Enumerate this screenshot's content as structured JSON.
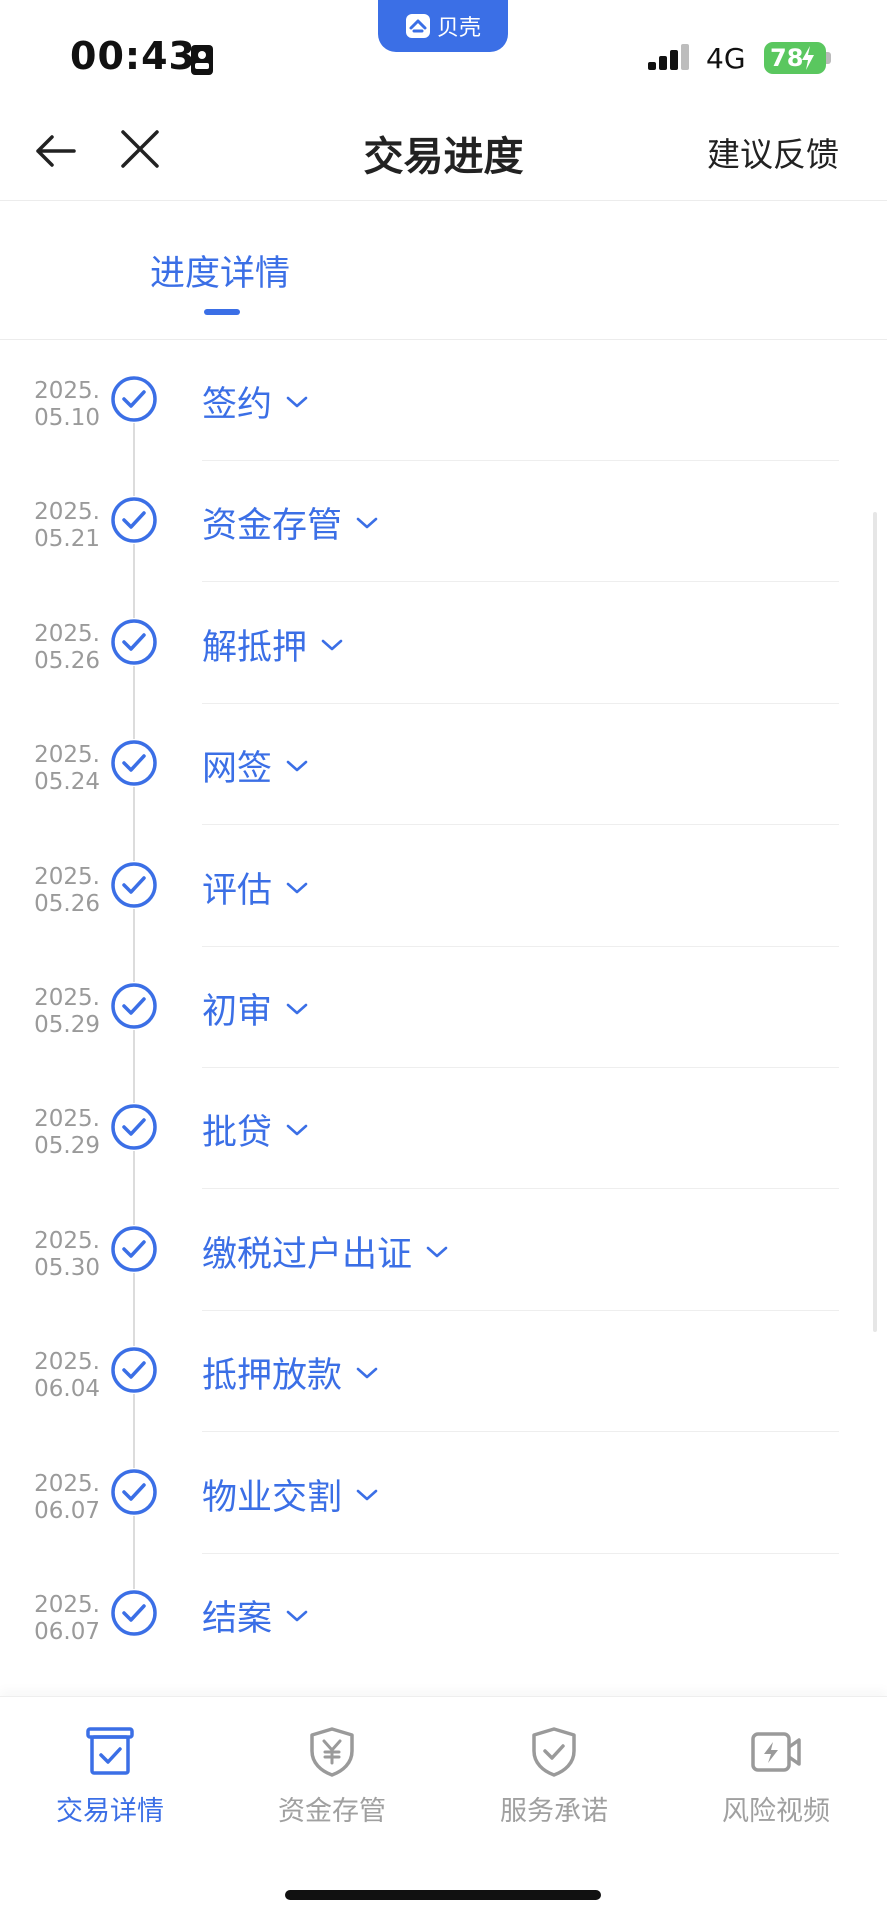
{
  "status_bar": {
    "time": "00:43",
    "app_name": "贝壳",
    "network": "4G",
    "battery": "78"
  },
  "nav": {
    "title": "交易进度",
    "feedback": "建议反馈"
  },
  "tab": {
    "label": "进度详情"
  },
  "steps": [
    {
      "year": "2025.",
      "day": "05.10",
      "title": "签约"
    },
    {
      "year": "2025.",
      "day": "05.21",
      "title": "资金存管"
    },
    {
      "year": "2025.",
      "day": "05.26",
      "title": "解抵押"
    },
    {
      "year": "2025.",
      "day": "05.24",
      "title": "网签"
    },
    {
      "year": "2025.",
      "day": "05.26",
      "title": "评估"
    },
    {
      "year": "2025.",
      "day": "05.29",
      "title": "初审"
    },
    {
      "year": "2025.",
      "day": "05.29",
      "title": "批贷"
    },
    {
      "year": "2025.",
      "day": "05.30",
      "title": "缴税过户出证"
    },
    {
      "year": "2025.",
      "day": "06.04",
      "title": "抵押放款"
    },
    {
      "year": "2025.",
      "day": "06.07",
      "title": "物业交割"
    },
    {
      "year": "2025.",
      "day": "06.07",
      "title": "结案"
    }
  ],
  "bottom_nav": [
    {
      "label": "交易详情",
      "icon": "checklist-box-icon",
      "active": true
    },
    {
      "label": "资金存管",
      "icon": "yuan-shield-icon",
      "active": false
    },
    {
      "label": "服务承诺",
      "icon": "check-shield-icon",
      "active": false
    },
    {
      "label": "风险视频",
      "icon": "video-bolt-icon",
      "active": false
    }
  ],
  "colors": {
    "accent": "#3b6fe6",
    "muted": "#a0a0a0",
    "battery": "#5ac75f"
  }
}
